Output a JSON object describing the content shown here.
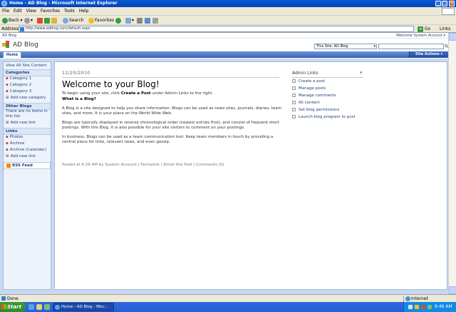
{
  "window": {
    "title": "Home - AD Blog - Microsoft Internet Explorer"
  },
  "menu": [
    "File",
    "Edit",
    "View",
    "Favorites",
    "Tools",
    "Help"
  ],
  "toolbar": {
    "back": "Back",
    "search": "Search",
    "favorites": "Favorites"
  },
  "address": {
    "label": "Address",
    "url": "http://www.adblog.com/default.aspx",
    "go": "Go",
    "links": "Links"
  },
  "site": {
    "crumb": "AD Blog",
    "welcome": "Welcome System Account ▾",
    "title": "AD Blog",
    "scope": "This Site: AD Blog",
    "home_tab": "Home",
    "site_actions": "Site Actions ▾"
  },
  "leftnav": {
    "view_all": "View All Site Content",
    "categories_hdr": "Categories",
    "categories": [
      "Category 1",
      "Category 2",
      "Category 3"
    ],
    "add_category": "Add new category",
    "other_blogs_hdr": "Other Blogs",
    "other_blogs_empty": "There are no items in this list.",
    "add_link": "Add new link",
    "links_hdr": "Links",
    "links": [
      "Photos",
      "Archive",
      "Archive (Calendar)"
    ],
    "add_link2": "Add new link",
    "rss": "RSS Feed"
  },
  "post": {
    "date": "12/20/2010",
    "title": "Welcome to your Blog!",
    "intro_prefix": "To begin using your site, click ",
    "intro_bold": "Create a Post",
    "intro_suffix": " under Admin Links to the right.",
    "what_is": "What is a Blog?",
    "p1": "A Blog is a site designed to help you share information. Blogs can be used as news sites, journals, diaries, team sites, and more. It is your place on the World Wide Web.",
    "p2": "Blogs are typically displayed in reverse chronological order (newest entries first), and consist of frequent short postings. With this Blog, it is also possible for your site visitors to comment on your postings.",
    "p3": "In business, Blogs can be used as a team communication tool. Keep team members in touch by providing a central place for links, relevant news, and even gossip.",
    "footer": "Posted at 6:26 AM by System Account    | Permalink | Email this Post | Comments (0)"
  },
  "admin": {
    "hdr": "Admin Links",
    "items": [
      "Create a post",
      "Manage posts",
      "Manage comments",
      "All content",
      "Set blog permissions",
      "Launch blog program to post"
    ]
  },
  "status": {
    "text": "Done",
    "zone": "Internet"
  },
  "taskbar": {
    "start": "Start",
    "task": "Home - AD Blog - Micr...",
    "clock": "9:46 AM"
  }
}
